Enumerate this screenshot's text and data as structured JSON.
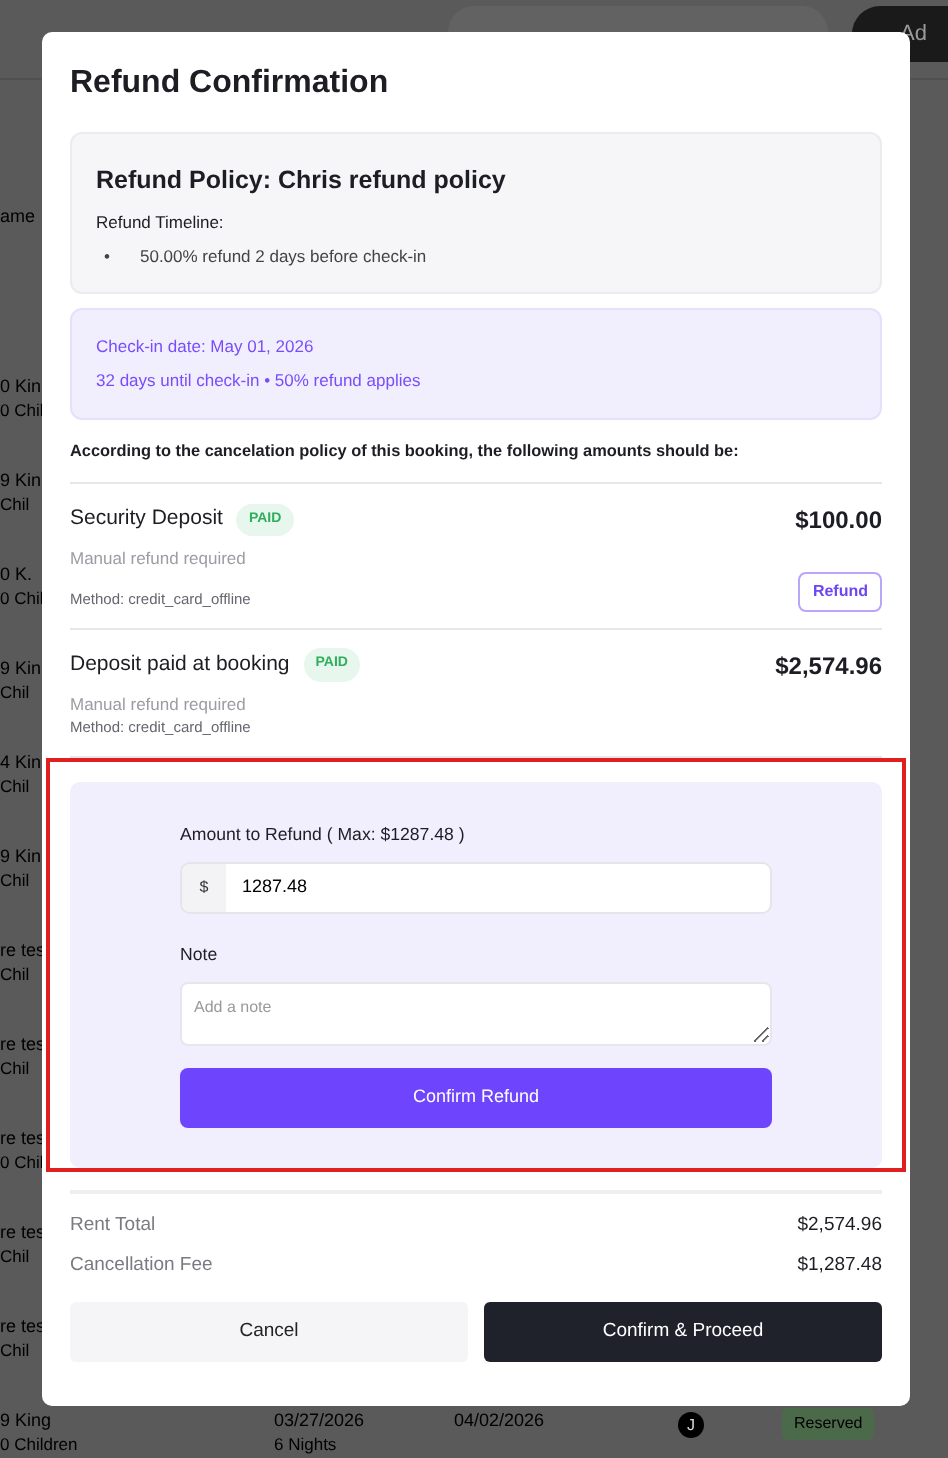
{
  "backdrop": {
    "add_button": "Ad",
    "column_header": "ame",
    "rows": [
      {
        "name": "0 Kin",
        "detail": "0 Chil"
      },
      {
        "name": "9 Kin",
        "detail": "Chil"
      },
      {
        "name": "0 K.",
        "detail": "0 Chil"
      },
      {
        "name": "9 Kin",
        "detail": "Chil"
      },
      {
        "name": "4 Kin",
        "detail": "Chil"
      },
      {
        "name": "9 Kin",
        "detail": "Chil"
      },
      {
        "name": "re tes",
        "detail": "Chil"
      },
      {
        "name": "re tes",
        "detail": "Chil"
      },
      {
        "name": "re tes",
        "detail": "0 Chil"
      },
      {
        "name": "re tes",
        "detail": "Chil"
      },
      {
        "name": "re tes",
        "detail": "Chil"
      },
      {
        "name": "9 King",
        "detail": "0 Children",
        "check_in": "03/27/2026",
        "nights": "6 Nights",
        "check_out": "04/02/2026",
        "guest_initial": "J",
        "status": "Reserved"
      }
    ]
  },
  "modal": {
    "title": "Refund Confirmation",
    "policy": {
      "title": "Refund Policy: Chris refund policy",
      "timeline_label": "Refund Timeline:",
      "bullet": "•",
      "timeline": [
        "50.00% refund 2 days before check-in"
      ]
    },
    "checkin": {
      "date_line": "Check-in date: May 01, 2026",
      "status_line": "32 days until check-in • 50% refund applies"
    },
    "intro": "According to the cancelation policy of this booking, the following amounts should be:",
    "payments": [
      {
        "name": "Security Deposit",
        "badge": "PAID",
        "amount": "$100.00",
        "note": "Manual refund required",
        "method": "Method: credit_card_offline",
        "action": "Refund"
      },
      {
        "name": "Deposit paid at booking",
        "badge": "PAID",
        "amount": "$2,574.96",
        "note": "Manual refund required",
        "method": "Method: credit_card_offline"
      }
    ],
    "refund_form": {
      "highlighted": true,
      "amount_label": "Amount to Refund ( Max: $1287.48 )",
      "prefix": "$",
      "amount": "1287.48",
      "note_label": "Note",
      "note_placeholder": "Add a note",
      "submit": "Confirm Refund"
    },
    "totals": [
      {
        "label": "Rent Total",
        "value": "$2,574.96"
      },
      {
        "label": "Cancellation Fee",
        "value": "$1,287.48"
      }
    ],
    "buttons": [
      {
        "label": "Cancel",
        "kind": "secondary"
      },
      {
        "label": "Confirm & Proceed",
        "kind": "primary"
      }
    ]
  }
}
